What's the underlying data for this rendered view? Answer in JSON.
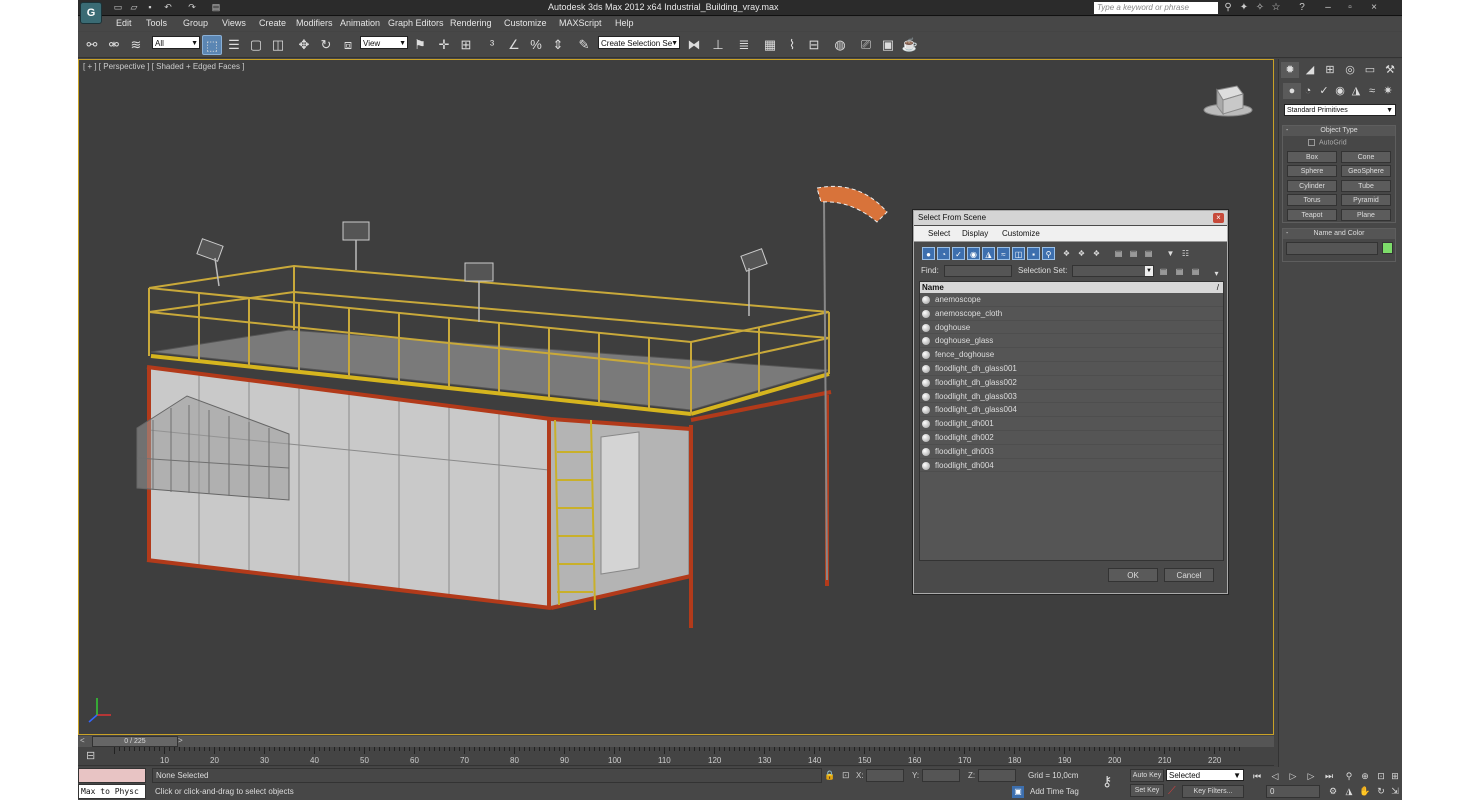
{
  "title_bar": {
    "logo": "G",
    "title": "Autodesk 3ds Max  2012 x64      Industrial_Building_vray.max",
    "search_placeholder": "Type a keyword or phrase"
  },
  "menu": [
    "Edit",
    "Tools",
    "Group",
    "Views",
    "Create",
    "Modifiers",
    "Animation",
    "Graph Editors",
    "Rendering",
    "Customize",
    "MAXScript",
    "Help"
  ],
  "toolbar": {
    "filter": "All",
    "coord_system": "View",
    "selection_set": "Create Selection Se"
  },
  "viewport": {
    "label": "[ + ] [ Perspective ] [ Shaded + Edged Faces ]"
  },
  "command_panel": {
    "dropdown": "Standard Primitives",
    "object_type": {
      "title": "Object Type",
      "autogrid": "AutoGrid",
      "buttons": [
        "Box",
        "Cone",
        "Sphere",
        "GeoSphere",
        "Cylinder",
        "Tube",
        "Torus",
        "Pyramid",
        "Teapot",
        "Plane"
      ]
    },
    "name_color": {
      "title": "Name and Color",
      "swatch_color": "#7ddc6a"
    }
  },
  "dialog": {
    "title": "Select From Scene",
    "menu": [
      "Select",
      "Display",
      "Customize"
    ],
    "find_label": "Find:",
    "selection_set_label": "Selection Set:",
    "column_name": "Name",
    "items": [
      "anemoscope",
      "anemoscope_cloth",
      "doghouse",
      "doghouse_glass",
      "fence_doghouse",
      "floodlight_dh_glass001",
      "floodlight_dh_glass002",
      "floodlight_dh_glass003",
      "floodlight_dh_glass004",
      "floodlight_dh001",
      "floodlight_dh002",
      "floodlight_dh003",
      "floodlight_dh004"
    ],
    "ok": "OK",
    "cancel": "Cancel"
  },
  "timeline": {
    "slider": "0 / 225",
    "ticks": [
      "10",
      "20",
      "30",
      "40",
      "50",
      "60",
      "70",
      "80",
      "90",
      "100",
      "110",
      "120",
      "130",
      "140",
      "150",
      "160",
      "170",
      "180",
      "190",
      "200",
      "210",
      "220"
    ]
  },
  "status": {
    "maxscript": "Max to Physc",
    "selection": "None Selected",
    "prompt": "Click or click-and-drag to select objects",
    "x_label": "X:",
    "y_label": "Y:",
    "z_label": "Z:",
    "grid": "Grid = 10,0cm",
    "add_time_tag": "Add Time Tag",
    "auto_key": "Auto Key",
    "set_key": "Set Key",
    "key_mode": "Selected",
    "key_filters": "Key Filters...",
    "frame": "0"
  }
}
